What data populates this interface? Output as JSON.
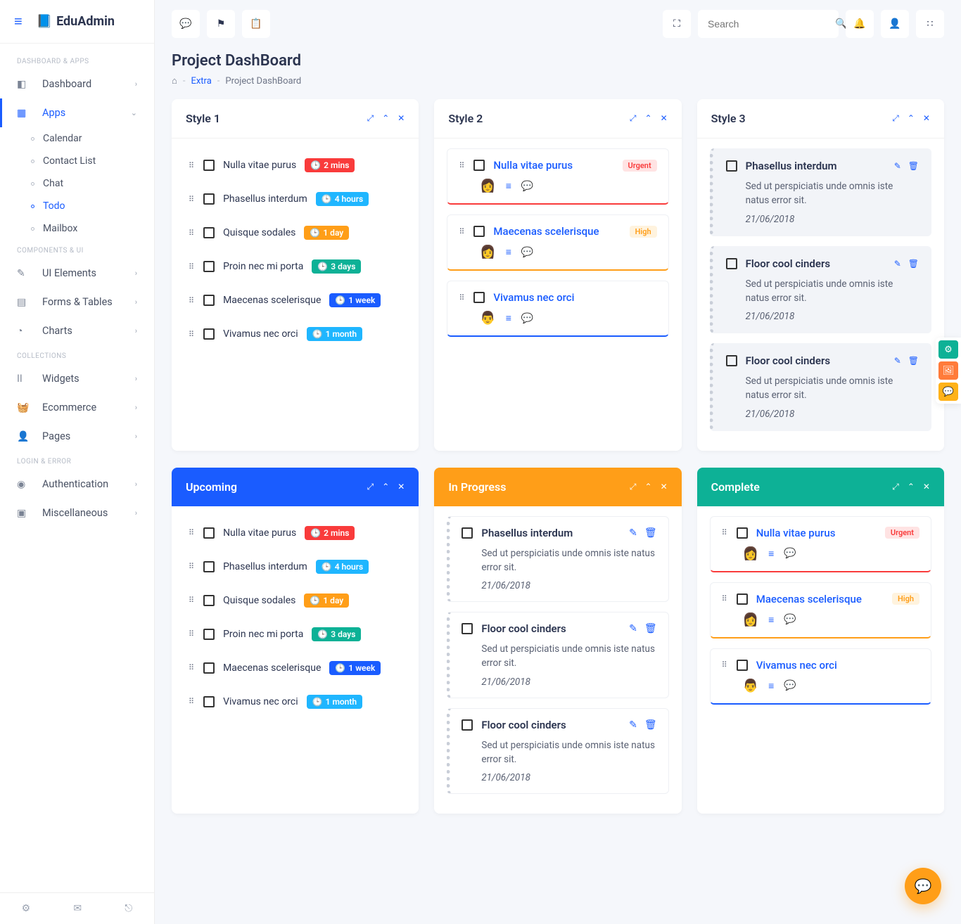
{
  "brand": {
    "name": "EduAdmin"
  },
  "search": {
    "placeholder": "Search"
  },
  "page": {
    "title": "Project DashBoard"
  },
  "breadcrumb": {
    "extra": "Extra",
    "current": "Project DashBoard"
  },
  "sidebar": {
    "sections": {
      "dash": "DASHBOARD & APPS",
      "comp": "COMPONENTS & UI",
      "coll": "COLLECTIONS",
      "login": "LOGIN & ERROR"
    },
    "items": {
      "dashboard": "Dashboard",
      "apps": "Apps",
      "ui": "UI Elements",
      "forms": "Forms & Tables",
      "charts": "Charts",
      "widgets": "Widgets",
      "ecommerce": "Ecommerce",
      "pages": "Pages",
      "auth": "Authentication",
      "misc": "Miscellaneous"
    },
    "apps_sub": {
      "calendar": "Calendar",
      "contact": "Contact List",
      "chat": "Chat",
      "todo": "Todo",
      "mailbox": "Mailbox"
    }
  },
  "cards": {
    "style1": "Style 1",
    "style2": "Style 2",
    "style3": "Style 3",
    "upcoming": "Upcoming",
    "inprogress": "In Progress",
    "complete": "Complete"
  },
  "tags": {
    "urgent": "Urgent",
    "high": "High"
  },
  "tasks": {
    "t1": {
      "label": "Nulla vitae purus",
      "time": "2 mins"
    },
    "t2": {
      "label": "Phasellus interdum",
      "time": "4 hours"
    },
    "t3": {
      "label": "Quisque sodales",
      "time": "1 day"
    },
    "t4": {
      "label": "Proin nec mi porta",
      "time": "3 days"
    },
    "t5": {
      "label": "Maecenas scelerisque",
      "time": "1 week"
    },
    "t6": {
      "label": "Vivamus nec orci",
      "time": "1 month"
    }
  },
  "style2": {
    "i1": "Nulla vitae purus",
    "i2": "Maecenas scelerisque",
    "i3": "Vivamus nec orci"
  },
  "style3": {
    "i1": {
      "title": "Phasellus interdum",
      "desc": "Sed ut perspiciatis unde omnis iste natus error sit.",
      "date": "21/06/2018"
    },
    "i2": {
      "title": "Floor cool cinders",
      "desc": "Sed ut perspiciatis unde omnis iste natus error sit.",
      "date": "21/06/2018"
    },
    "i3": {
      "title": "Floor cool cinders",
      "desc": "Sed ut perspiciatis unde omnis iste natus error sit.",
      "date": "21/06/2018"
    }
  },
  "inprogress": {
    "i1": {
      "title": "Phasellus interdum",
      "desc": "Sed ut perspiciatis unde omnis iste natus error sit.",
      "date": "21/06/2018"
    },
    "i2": {
      "title": "Floor cool cinders",
      "desc": "Sed ut perspiciatis unde omnis iste natus error sit.",
      "date": "21/06/2018"
    },
    "i3": {
      "title": "Floor cool cinders",
      "desc": "Sed ut perspiciatis unde omnis iste natus error sit.",
      "date": "21/06/2018"
    }
  },
  "complete": {
    "i1": "Nulla vitae purus",
    "i2": "Maecenas scelerisque",
    "i3": "Vivamus nec orci"
  }
}
